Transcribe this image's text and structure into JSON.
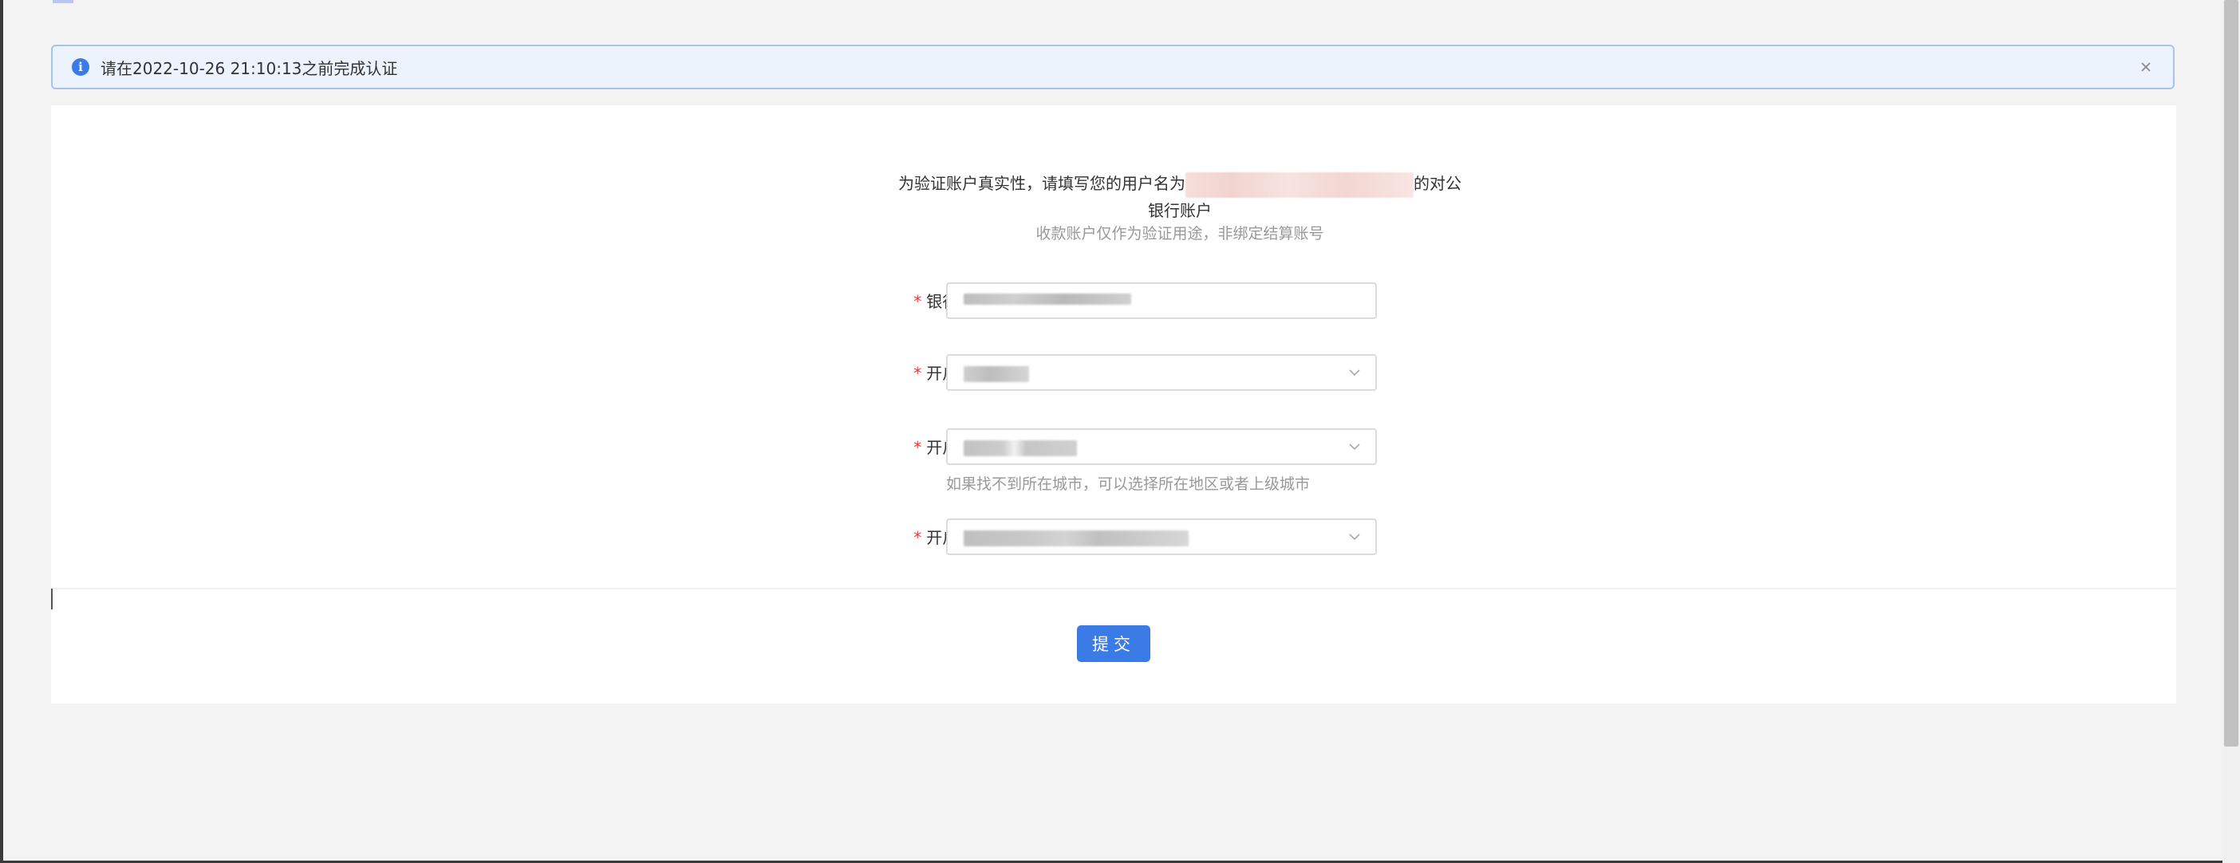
{
  "alert": {
    "text": "请在2022-10-26 21:10:13之前完成认证",
    "info_icon": "i",
    "close_icon": "×"
  },
  "intro": {
    "before": "为验证账户真实性，请填写您的用户名为",
    "after": "的对公",
    "line2": "银行账户",
    "note": "收款账户仅作为验证用途，非绑定结算账号"
  },
  "form": {
    "required_mark": "*",
    "bank_account_label": "银行账号:",
    "bank_label": "开户银行:",
    "region_label": "开户地区:",
    "region_helper": "如果找不到所在城市，可以选择所在地区或者上级城市",
    "branch_label": "开户支行:"
  },
  "submit_label": "提交",
  "colors": {
    "primary": "#3b7be6",
    "alert_bg": "#ecf3fd",
    "alert_border": "#a5c4ee",
    "required": "#e23b3b"
  }
}
